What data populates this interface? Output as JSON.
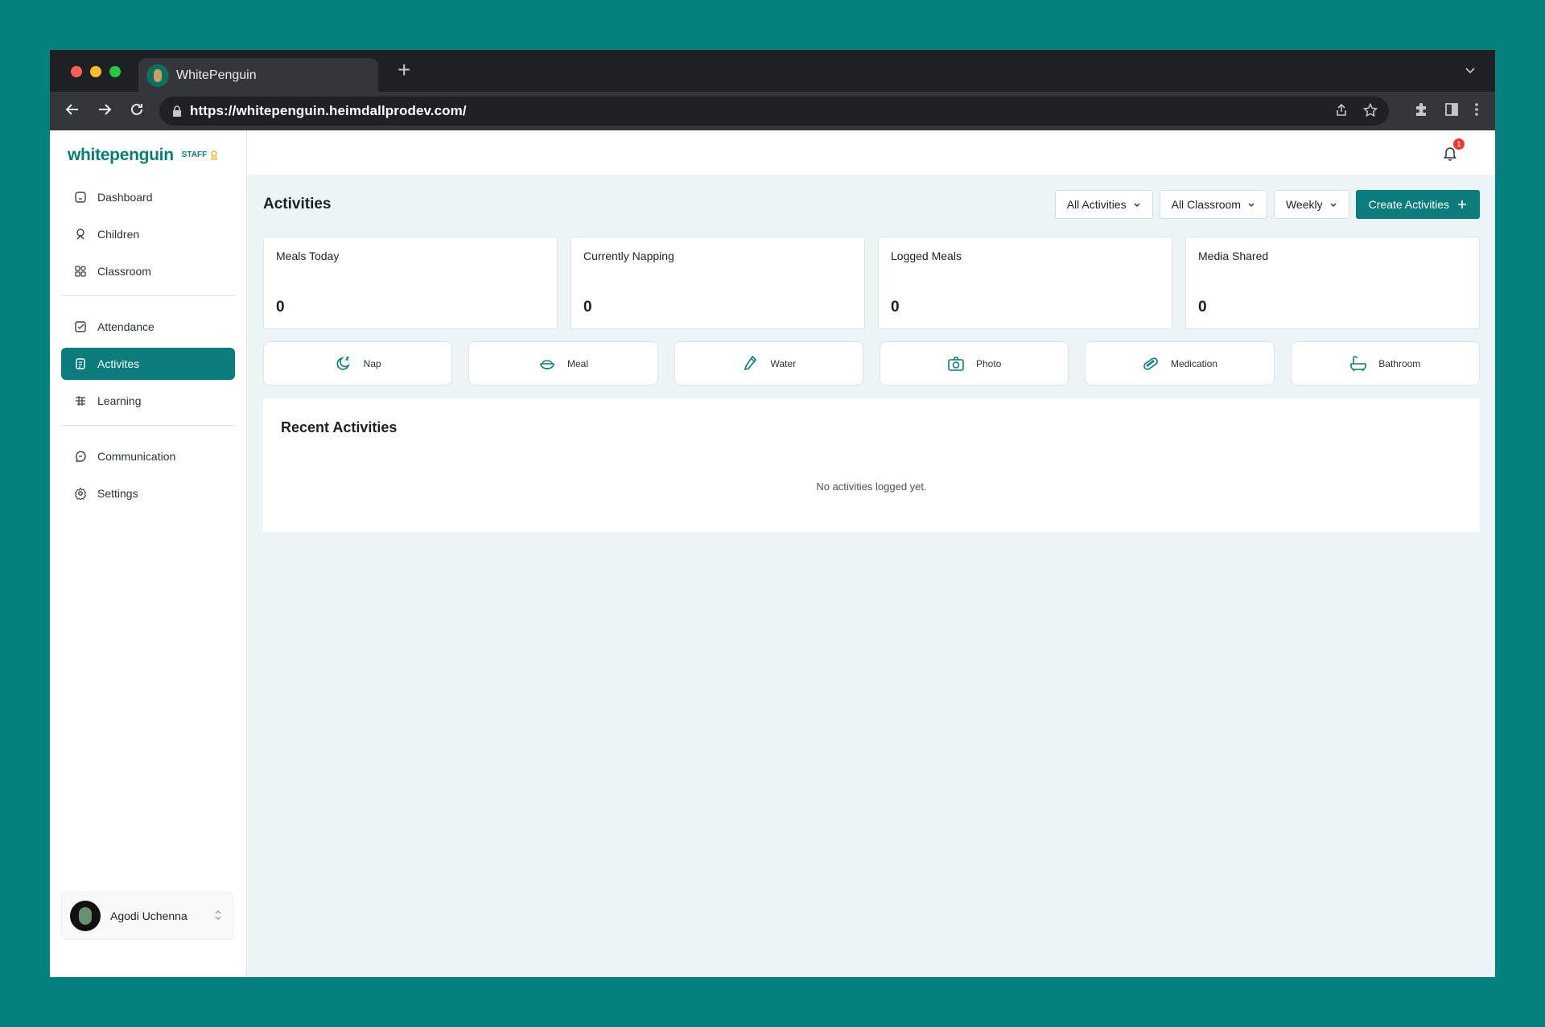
{
  "browser": {
    "tab_title": "WhitePenguin",
    "url": "https://whitepenguin.heimdallprodev.com/"
  },
  "sidebar": {
    "logo": "whitepenguin",
    "role": "STAFF",
    "groups": [
      [
        {
          "label": "Dashboard",
          "icon": "home-icon"
        },
        {
          "label": "Children",
          "icon": "child-icon"
        },
        {
          "label": "Classroom",
          "icon": "grid-icon"
        }
      ],
      [
        {
          "label": "Attendance",
          "icon": "checkbox-icon"
        },
        {
          "label": "Activites",
          "icon": "clipboard-icon",
          "active": true
        },
        {
          "label": "Learning",
          "icon": "learning-icon"
        }
      ],
      [
        {
          "label": "Communication",
          "icon": "chat-icon"
        },
        {
          "label": "Settings",
          "icon": "gear-icon"
        }
      ]
    ],
    "user": {
      "name": "Agodi Uchenna"
    }
  },
  "topbar": {
    "notification_count": "1"
  },
  "page": {
    "title": "Activities",
    "filters": [
      "All Activities",
      "All Classroom",
      "Weekly"
    ],
    "create_label": "Create Activities"
  },
  "stats": [
    {
      "label": "Meals Today",
      "value": "0"
    },
    {
      "label": "Currently Napping",
      "value": "0"
    },
    {
      "label": "Logged Meals",
      "value": "0"
    },
    {
      "label": "Media Shared",
      "value": "0"
    }
  ],
  "quick_actions": [
    {
      "label": "Nap",
      "icon": "moon-icon"
    },
    {
      "label": "Meal",
      "icon": "bowl-icon"
    },
    {
      "label": "Water",
      "icon": "bottle-icon"
    },
    {
      "label": "Photo",
      "icon": "camera-icon"
    },
    {
      "label": "Medication",
      "icon": "pill-icon"
    },
    {
      "label": "Bathroom",
      "icon": "bathtub-icon"
    }
  ],
  "recent": {
    "title": "Recent Activities",
    "empty_text": "No activities logged yet."
  },
  "colors": {
    "accent": "#0b7b7b",
    "page_bg": "#067f7f",
    "content_bg": "#edf4f5"
  }
}
